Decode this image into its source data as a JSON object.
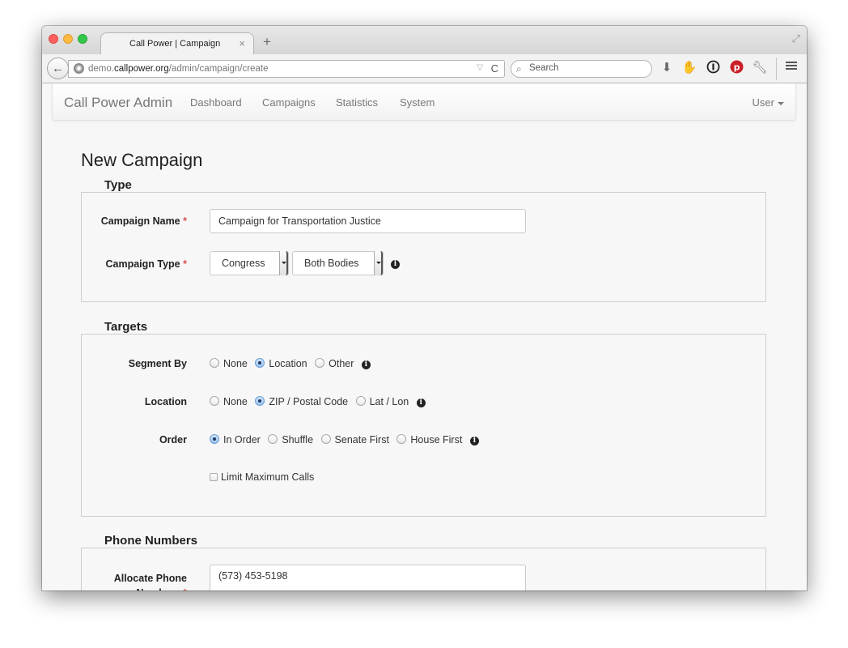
{
  "browser": {
    "tab_title": "Call Power | Campaign",
    "tab_close": "×",
    "new_tab": "+",
    "url_prefix": "demo.",
    "url_domain": "callpower.org",
    "url_path": "/admin/campaign/create",
    "search_placeholder": "Search"
  },
  "appnav": {
    "brand": "Call Power Admin",
    "links": [
      "Dashboard",
      "Campaigns",
      "Statistics",
      "System"
    ],
    "user": "User"
  },
  "page_title": "New Campaign",
  "type_section": {
    "legend": "Type",
    "campaign_name_label": "Campaign Name",
    "campaign_name_value": "Campaign for Transportation Justice",
    "campaign_type_label": "Campaign Type",
    "campaign_type_value": "Congress",
    "campaign_subtype_value": "Both Bodies",
    "required_mark": "*"
  },
  "targets_section": {
    "legend": "Targets",
    "segment_by": {
      "label": "Segment By",
      "options": [
        "None",
        "Location",
        "Other"
      ],
      "selected": "Location"
    },
    "location": {
      "label": "Location",
      "options": [
        "None",
        "ZIP / Postal Code",
        "Lat / Lon"
      ],
      "selected": "ZIP / Postal Code"
    },
    "order": {
      "label": "Order",
      "options": [
        "In Order",
        "Shuffle",
        "Senate First",
        "House First"
      ],
      "selected": "In Order"
    },
    "limit_max_calls": "Limit Maximum Calls"
  },
  "phone_section": {
    "legend": "Phone Numbers",
    "allocate_label": "Allocate Phone Numbers",
    "allocate_value": "(573) 453-5198"
  },
  "icons": {
    "info": "i",
    "back": "←",
    "reload": "C",
    "search": "⌕"
  },
  "colors": {
    "required": "#d9534f",
    "radio_selected": "#6b9fd6",
    "pinterest": "#cb2027"
  }
}
